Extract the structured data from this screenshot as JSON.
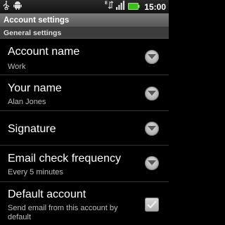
{
  "status_bar": {
    "time": "15:00",
    "icons": [
      "usb-icon",
      "android-icon",
      "data-transfer-icon",
      "signal-icon",
      "battery-icon"
    ],
    "battery_color": "#3fbf1f"
  },
  "titlebar": {
    "title": "Account settings"
  },
  "section": {
    "title": "General settings"
  },
  "settings": [
    {
      "title": "Account name",
      "summary": "Work",
      "control": "chevron-icon"
    },
    {
      "title": "Your name",
      "summary": "Alan Jones",
      "control": "chevron-icon"
    },
    {
      "title": "Signature",
      "summary": "",
      "control": "chevron-icon"
    },
    {
      "title": "Email check frequency",
      "summary": "Every 5 minutes",
      "control": "chevron-icon"
    },
    {
      "title": "Default account",
      "summary": "Send email from this account by default",
      "control": "checkbox",
      "checked": true
    }
  ]
}
